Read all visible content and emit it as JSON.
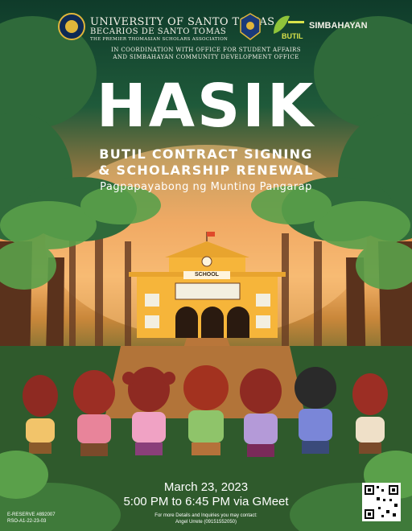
{
  "header": {
    "university": "UNIVERSITY OF SANTO TOMAS",
    "group": "BECARIOS DE SANTO TOMAS",
    "group_tagline": "THE PREMIER THOMASIAN SCHOLARS ASSOCIATION",
    "partner_logo_label": "BUTIL",
    "simbahayan_label": "SIMBAHAYAN",
    "coordination_line1": "IN COORDINATION WITH OFFICE FOR STUDENT AFFAIRS",
    "coordination_line2": "AND SIMBAHAYAN COMMUNITY DEVELOPMENT OFFICE"
  },
  "title": "HASIK",
  "subtitle_line1": "BUTIL CONTRACT SIGNING",
  "subtitle_line2": "& SCHOLARSHIP RENEWAL",
  "tagline": "Pagpapayabong ng Munting Pangarap",
  "school_sign": "SCHOOL",
  "event": {
    "date": "March 23, 2023",
    "time": "5:00 PM to 6:45 PM via GMeet"
  },
  "contact": {
    "line1": "For more Details and Inquiries you may contact:",
    "line2": "Angel Urrete (09151552050)"
  },
  "reserve": {
    "line1": "E-RESERVE #892007",
    "line2": "RSO-A1-22-23-03"
  },
  "colors": {
    "building": "#f6b53a",
    "path": "#b9763a",
    "sky_glow": "#f6b36a",
    "leaf": "#4e9a3a"
  }
}
